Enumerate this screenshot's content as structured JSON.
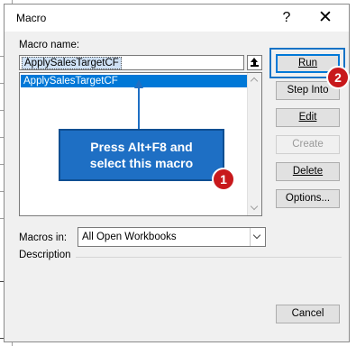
{
  "dialog": {
    "title": "Macro",
    "help_glyph": "?",
    "close_glyph": "✕"
  },
  "macro_name": {
    "label": "Macro name:",
    "value": "ApplySalesTargetCF",
    "list": [
      "ApplySalesTargetCF"
    ]
  },
  "buttons": {
    "run": "Run",
    "step_into": "Step Into",
    "edit": "Edit",
    "create": "Create",
    "delete": "Delete",
    "options": "Options...",
    "cancel": "Cancel"
  },
  "macros_in": {
    "label": "Macros in:",
    "value": "All Open Workbooks"
  },
  "description": {
    "label": "Description"
  },
  "annotations": {
    "callout_line1": "Press Alt+F8 and",
    "callout_line2": "select this macro",
    "badge1": "1",
    "badge2": "2",
    "callout_color": "#1e6fc4",
    "badge_color": "#c8191c"
  }
}
